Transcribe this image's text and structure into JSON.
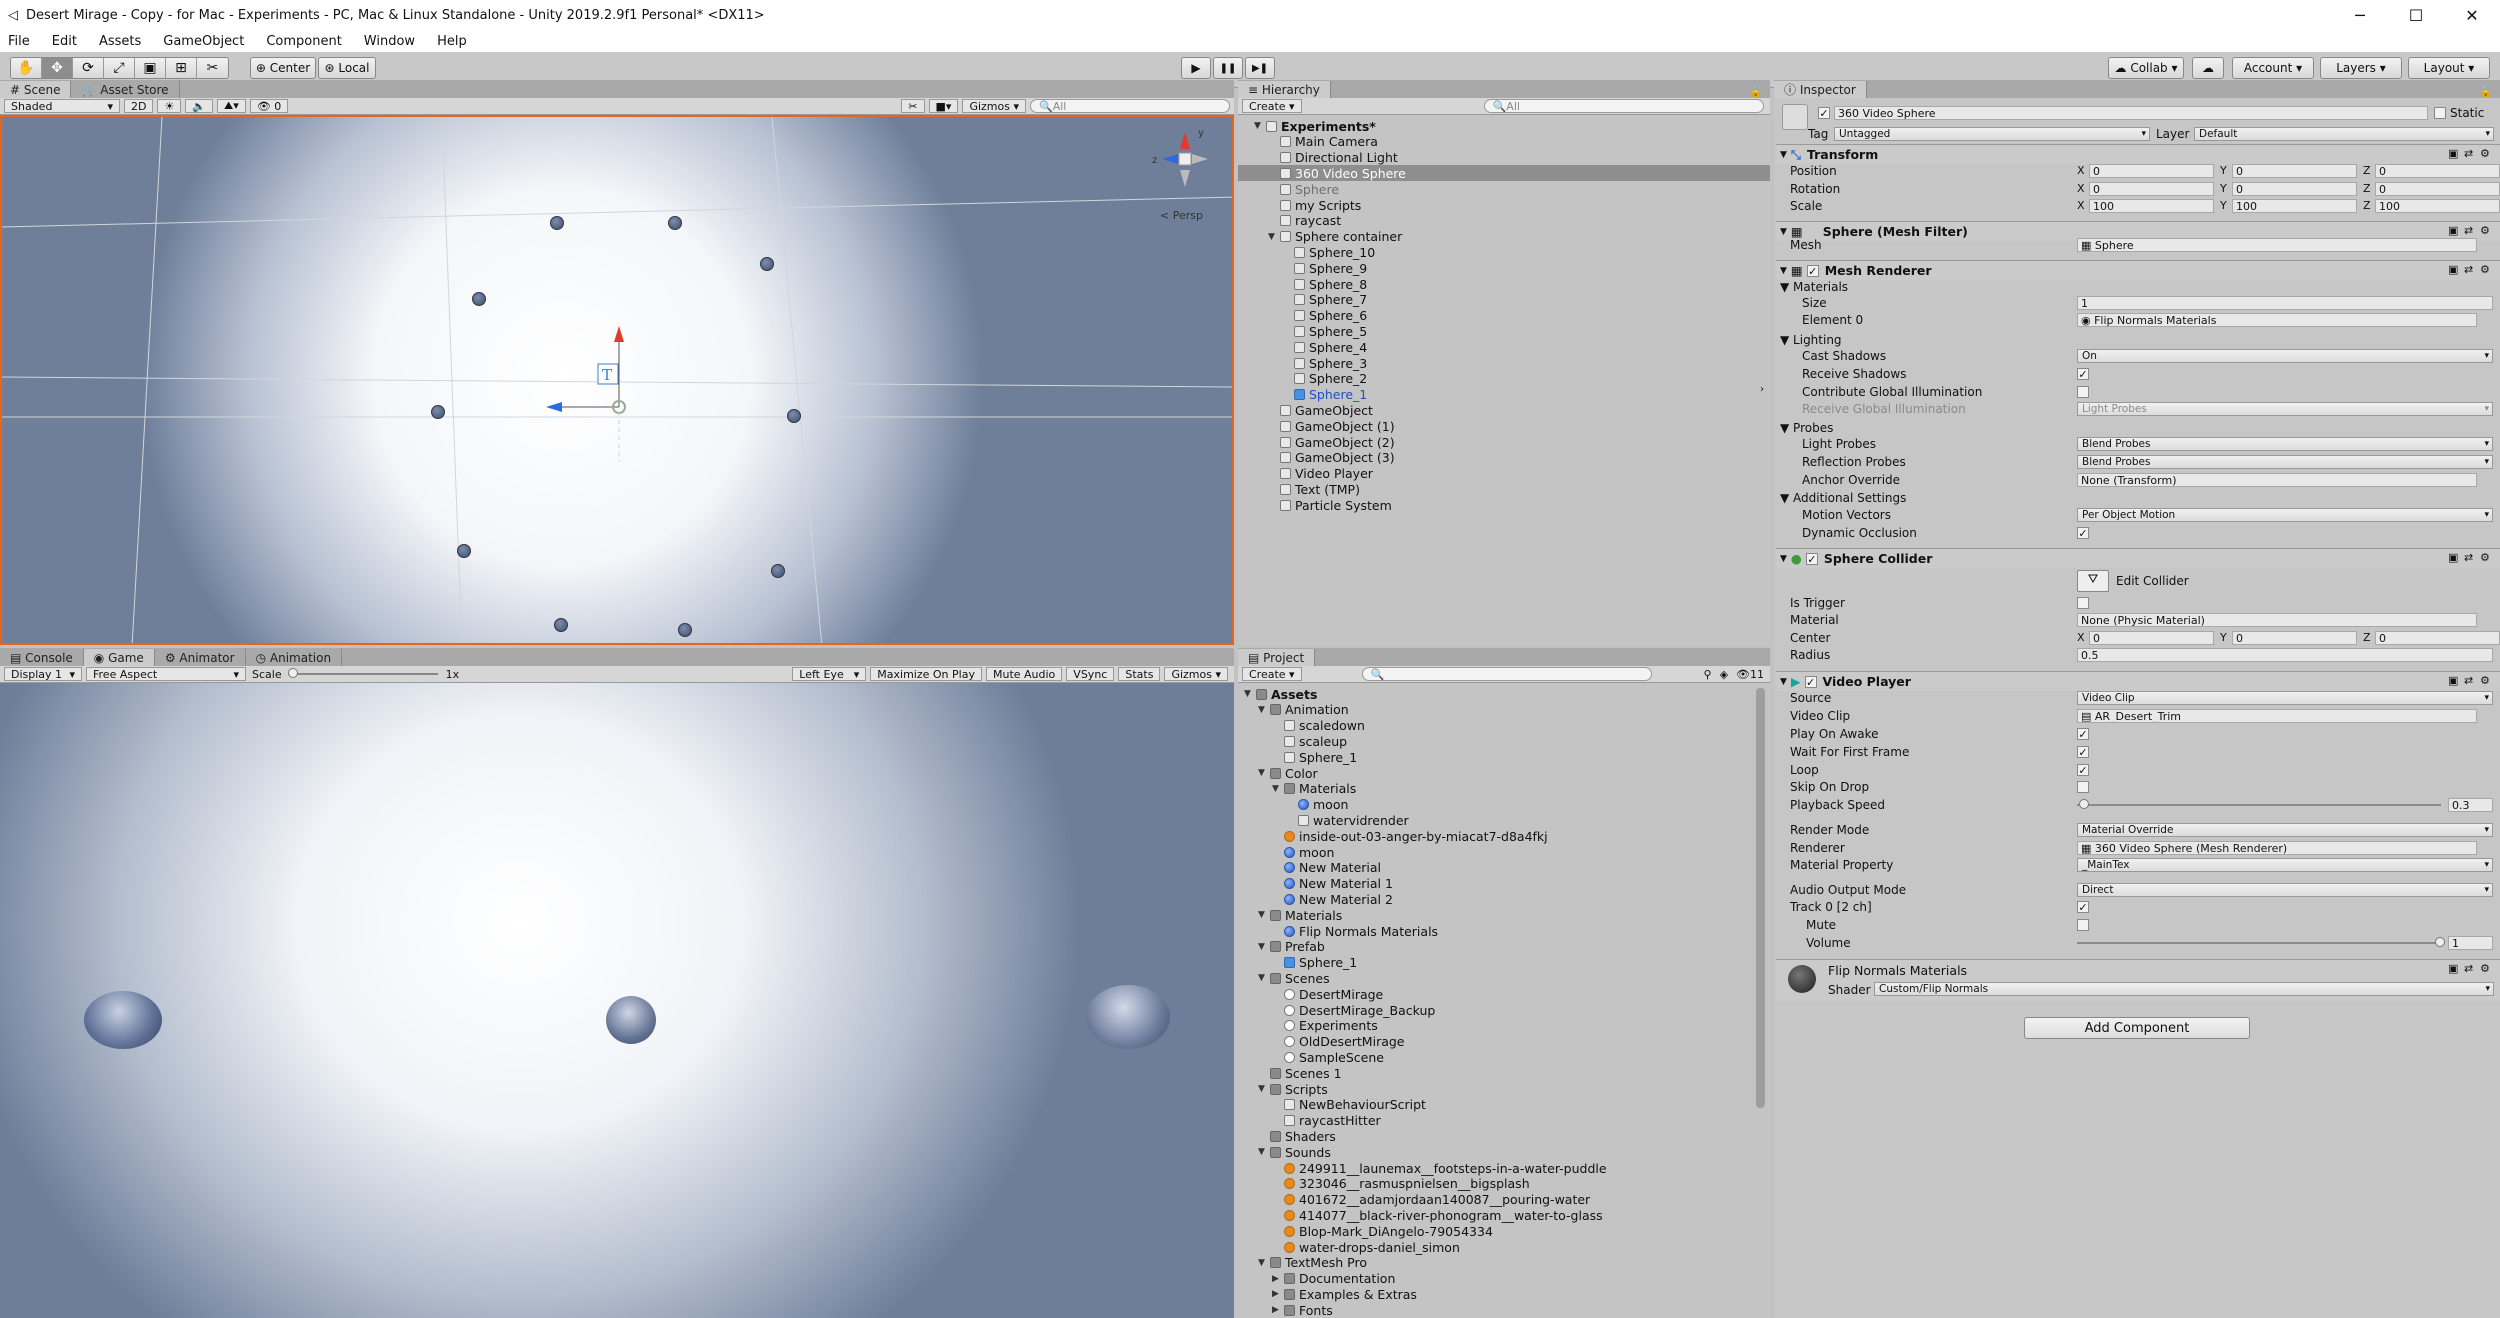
{
  "window": {
    "title": "Desert Mirage - Copy - for Mac - Experiments - PC, Mac & Linux Standalone - Unity 2019.2.9f1 Personal* <DX11>",
    "minimize": "─",
    "maximize": "☐",
    "close": "✕"
  },
  "menu": [
    "File",
    "Edit",
    "Assets",
    "GameObject",
    "Component",
    "Window",
    "Help"
  ],
  "toolbar": {
    "center": "Center",
    "local": "Local",
    "collab": "Collab ▾",
    "account": "Account ▾",
    "layers": "Layers ▾",
    "layout": "Layout ▾",
    "play": "▶",
    "pause": "❚❚",
    "step": "▶❚"
  },
  "scene": {
    "tabs": [
      "Scene",
      "Asset Store"
    ],
    "shading": "Shaded",
    "mode2d": "2D",
    "gizmos": "Gizmos",
    "search": "All",
    "persp": "< Persp",
    "counter": "0"
  },
  "game": {
    "tabs": [
      "Console",
      "Game",
      "Animator",
      "Animation"
    ],
    "display": "Display 1",
    "aspect": "Free Aspect",
    "scale_label": "Scale",
    "scale_value": "1x",
    "eye": "Left Eye",
    "buttons": [
      "Maximize On Play",
      "Mute Audio",
      "VSync",
      "Stats",
      "Gizmos"
    ]
  },
  "hierarchy": {
    "tab": "Hierarchy",
    "create": "Create",
    "search": "All",
    "items": [
      {
        "label": "Experiments*",
        "level": 0,
        "arrow": "▼",
        "bold": true
      },
      {
        "label": "Main Camera",
        "level": 1
      },
      {
        "label": "Directional Light",
        "level": 1
      },
      {
        "label": "360 Video Sphere",
        "level": 1,
        "selected": true
      },
      {
        "label": "Sphere",
        "level": 1,
        "dim": true
      },
      {
        "label": "my Scripts",
        "level": 1
      },
      {
        "label": "raycast",
        "level": 1
      },
      {
        "label": "Sphere container",
        "level": 1,
        "arrow": "▼"
      },
      {
        "label": "Sphere_10",
        "level": 2
      },
      {
        "label": "Sphere_9",
        "level": 2
      },
      {
        "label": "Sphere_8",
        "level": 2
      },
      {
        "label": "Sphere_7",
        "level": 2
      },
      {
        "label": "Sphere_6",
        "level": 2
      },
      {
        "label": "Sphere_5",
        "level": 2
      },
      {
        "label": "Sphere_4",
        "level": 2
      },
      {
        "label": "Sphere_3",
        "level": 2
      },
      {
        "label": "Sphere_2",
        "level": 2
      },
      {
        "label": "Sphere_1",
        "level": 2,
        "blue": true
      },
      {
        "label": "GameObject",
        "level": 1
      },
      {
        "label": "GameObject (1)",
        "level": 1
      },
      {
        "label": "GameObject (2)",
        "level": 1
      },
      {
        "label": "GameObject (3)",
        "level": 1
      },
      {
        "label": "Video Player",
        "level": 1
      },
      {
        "label": "Text (TMP)",
        "level": 1
      },
      {
        "label": "Particle System",
        "level": 1
      }
    ]
  },
  "project": {
    "tab": "Project",
    "create": "Create",
    "counter": "11",
    "items": [
      {
        "label": "Assets",
        "level": 0,
        "arrow": "▼",
        "icon": "folder",
        "bold": true
      },
      {
        "label": "Animation",
        "level": 1,
        "arrow": "▼",
        "icon": "folder"
      },
      {
        "label": "scaledown",
        "level": 2,
        "icon": "file"
      },
      {
        "label": "scaleup",
        "level": 2,
        "icon": "file"
      },
      {
        "label": "Sphere_1",
        "level": 2,
        "icon": "file"
      },
      {
        "label": "Color",
        "level": 1,
        "arrow": "▼",
        "icon": "folder"
      },
      {
        "label": "Materials",
        "level": 2,
        "arrow": "▼",
        "icon": "folder"
      },
      {
        "label": "moon",
        "level": 3,
        "icon": "mat"
      },
      {
        "label": "watervidrender",
        "level": 3,
        "icon": "file"
      },
      {
        "label": "inside-out-03-anger-by-miacat7-d8a4fkj",
        "level": 2,
        "icon": "sound"
      },
      {
        "label": "moon",
        "level": 2,
        "icon": "mat"
      },
      {
        "label": "New Material",
        "level": 2,
        "icon": "mat"
      },
      {
        "label": "New Material 1",
        "level": 2,
        "icon": "mat"
      },
      {
        "label": "New Material 2",
        "level": 2,
        "icon": "mat"
      },
      {
        "label": "Materials",
        "level": 1,
        "arrow": "▼",
        "icon": "folder"
      },
      {
        "label": "Flip Normals Materials",
        "level": 2,
        "icon": "mat"
      },
      {
        "label": "Prefab",
        "level": 1,
        "arrow": "▼",
        "icon": "folder"
      },
      {
        "label": "Sphere_1",
        "level": 2,
        "icon": "prefab"
      },
      {
        "label": "Scenes",
        "level": 1,
        "arrow": "▼",
        "icon": "folder"
      },
      {
        "label": "DesertMirage",
        "level": 2,
        "icon": "scene"
      },
      {
        "label": "DesertMirage_Backup",
        "level": 2,
        "icon": "scene"
      },
      {
        "label": "Experiments",
        "level": 2,
        "icon": "scene"
      },
      {
        "label": "OldDesertMirage",
        "level": 2,
        "icon": "scene"
      },
      {
        "label": "SampleScene",
        "level": 2,
        "icon": "scene"
      },
      {
        "label": "Scenes 1",
        "level": 1,
        "icon": "folder"
      },
      {
        "label": "Scripts",
        "level": 1,
        "arrow": "▼",
        "icon": "folder"
      },
      {
        "label": "NewBehaviourScript",
        "level": 2,
        "icon": "file"
      },
      {
        "label": "raycastHitter",
        "level": 2,
        "icon": "file"
      },
      {
        "label": "Shaders",
        "level": 1,
        "icon": "folder"
      },
      {
        "label": "Sounds",
        "level": 1,
        "arrow": "▼",
        "icon": "folder"
      },
      {
        "label": "249911__launemax__footsteps-in-a-water-puddle",
        "level": 2,
        "icon": "sound"
      },
      {
        "label": "323046__rasmuspnielsen__bigsplash",
        "level": 2,
        "icon": "sound"
      },
      {
        "label": "401672__adamjordaan140087__pouring-water",
        "level": 2,
        "icon": "sound"
      },
      {
        "label": "414077__black-river-phonogram__water-to-glass",
        "level": 2,
        "icon": "sound"
      },
      {
        "label": "Blop-Mark_DiAngelo-79054334",
        "level": 2,
        "icon": "sound"
      },
      {
        "label": "water-drops-daniel_simon",
        "level": 2,
        "icon": "sound"
      },
      {
        "label": "TextMesh Pro",
        "level": 1,
        "arrow": "▼",
        "icon": "folder"
      },
      {
        "label": "Documentation",
        "level": 2,
        "arrow": "▶",
        "icon": "folder"
      },
      {
        "label": "Examples & Extras",
        "level": 2,
        "arrow": "▶",
        "icon": "folder"
      },
      {
        "label": "Fonts",
        "level": 2,
        "arrow": "▶",
        "icon": "folder"
      }
    ]
  },
  "inspector": {
    "tab": "Inspector",
    "name": "360 Video Sphere",
    "static": "Static",
    "tag_label": "Tag",
    "tag": "Untagged",
    "layer_label": "Layer",
    "layer": "Default",
    "transform": {
      "title": "Transform",
      "rows": [
        {
          "label": "Position",
          "x": "0",
          "y": "0",
          "z": "0"
        },
        {
          "label": "Rotation",
          "x": "0",
          "y": "0",
          "z": "0"
        },
        {
          "label": "Scale",
          "x": "100",
          "y": "100",
          "z": "100"
        }
      ]
    },
    "meshfilter": {
      "title": "Sphere (Mesh Filter)",
      "mesh_label": "Mesh",
      "mesh": "Sphere"
    },
    "renderer": {
      "title": "Mesh Renderer",
      "materials": "Materials",
      "size_label": "Size",
      "size": "1",
      "element_label": "Element 0",
      "element": "Flip Normals Materials",
      "lighting": "Lighting",
      "cast_label": "Cast Shadows",
      "cast": "On",
      "receive_label": "Receive Shadows",
      "gi_label": "Contribute Global Illumination",
      "rgi_label": "Receive Global Illumination",
      "rgi": "Light Probes",
      "probes": "Probes",
      "lp_label": "Light Probes",
      "lp": "Blend Probes",
      "rp_label": "Reflection Probes",
      "rp": "Blend Probes",
      "anchor_label": "Anchor Override",
      "anchor": "None (Transform)",
      "additional": "Additional Settings",
      "mv_label": "Motion Vectors",
      "mv": "Per Object Motion",
      "occ_label": "Dynamic Occlusion"
    },
    "collider": {
      "title": "Sphere Collider",
      "edit": "Edit Collider",
      "trigger_label": "Is Trigger",
      "material_label": "Material",
      "material": "None (Physic Material)",
      "center_label": "Center",
      "cx": "0",
      "cy": "0",
      "cz": "0",
      "radius_label": "Radius",
      "radius": "0.5"
    },
    "video": {
      "title": "Video Player",
      "source_label": "Source",
      "source": "Video Clip",
      "clip_label": "Video Clip",
      "clip": "AR_Desert_Trim",
      "awake_label": "Play On Awake",
      "wait_label": "Wait For First Frame",
      "loop_label": "Loop",
      "skip_label": "Skip On Drop",
      "speed_label": "Playback Speed",
      "speed": "0.3",
      "speed_fraction": 0.3,
      "render_label": "Render Mode",
      "render": "Material Override",
      "renderer_label": "Renderer",
      "renderer": "360 Video Sphere (Mesh Renderer)",
      "prop_label": "Material Property",
      "prop": "_MainTex",
      "audio_label": "Audio Output Mode",
      "audio": "Direct",
      "track_label": "Track 0 [2 ch]",
      "mute_label": "Mute",
      "volume_label": "Volume",
      "volume": "1",
      "volume_fraction": 1
    },
    "material": {
      "title": "Flip Normals Materials",
      "shader_label": "Shader",
      "shader": "Custom/Flip Normals"
    },
    "add_component": "Add Component"
  }
}
